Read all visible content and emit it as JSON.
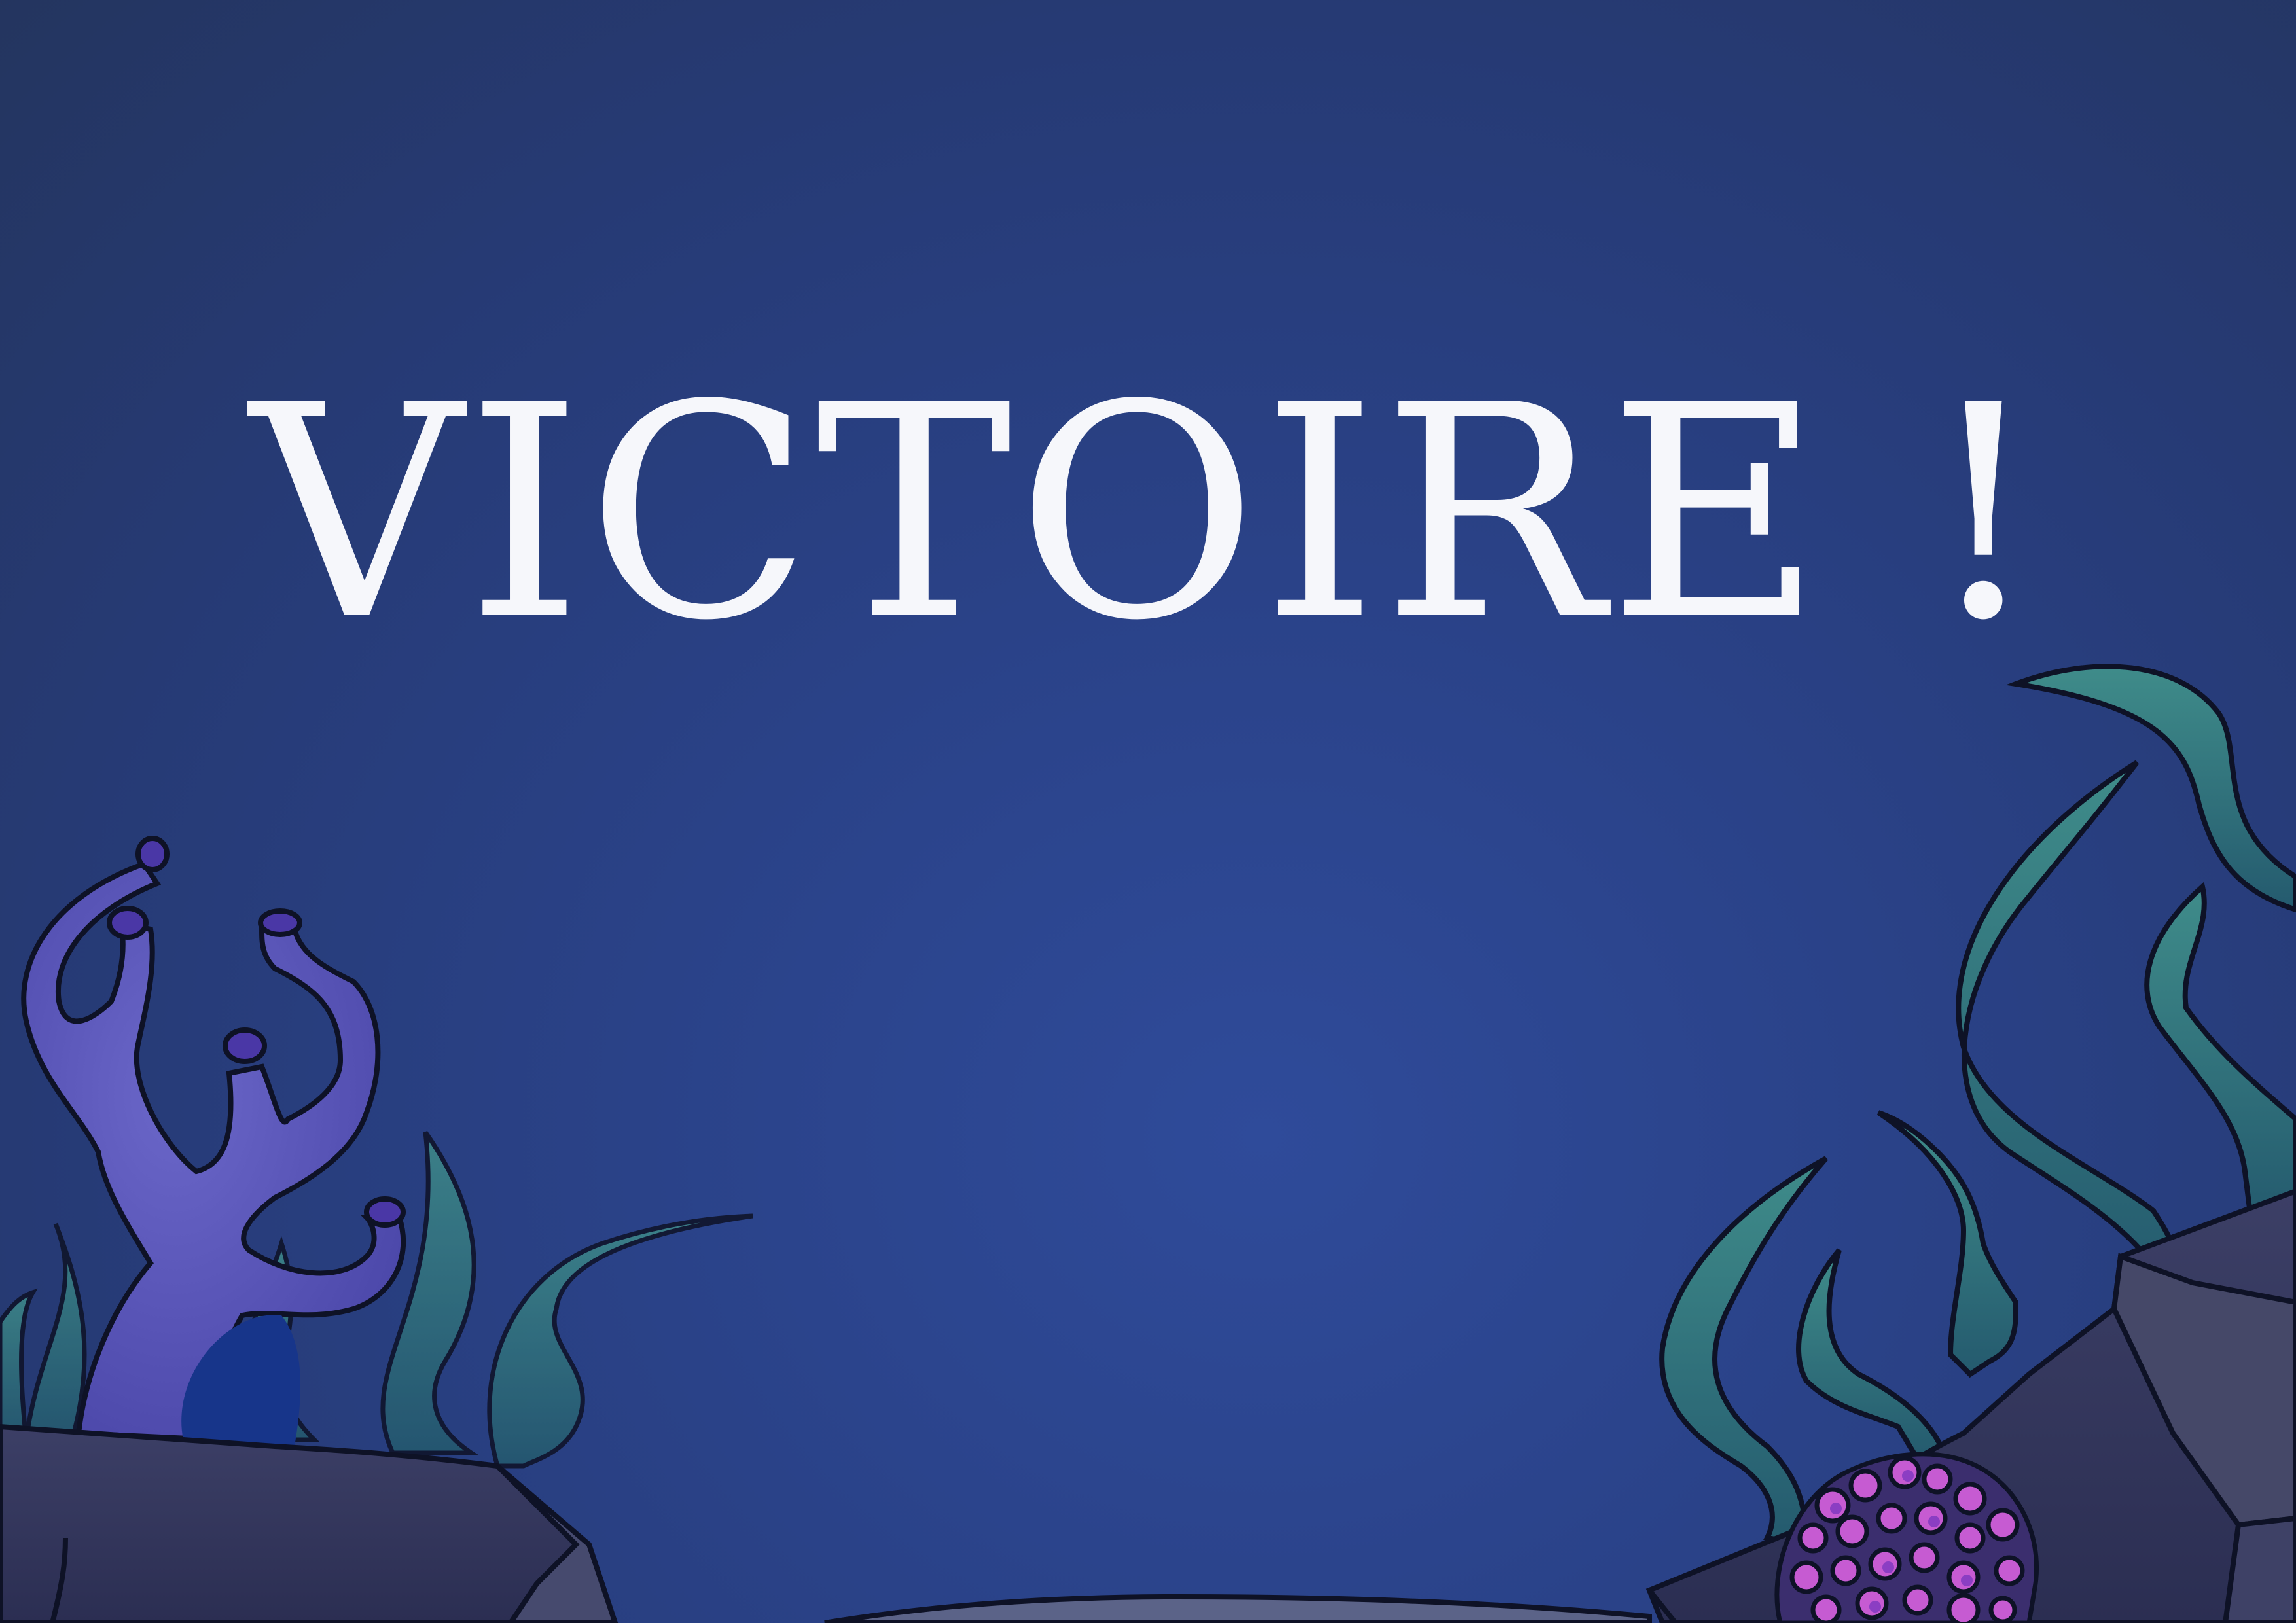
{
  "screen": {
    "title": "VICTOIRE !"
  },
  "colors": {
    "background_top": "#24355f",
    "background_center": "#2f4b9a",
    "title": "#f6f7fb",
    "outline": "#0e1226",
    "rock": "#3a3d62",
    "seaweed": "#2d6b78",
    "seaweed_light": "#3f8c8a",
    "purple_coral": "#5d56b8",
    "coral_tips": "#4a37a6",
    "pink_coral": "#c14fc9"
  },
  "decor": [
    "purple-coral",
    "seaweed-left",
    "seaweed-right",
    "rock-left",
    "rock-right",
    "pink-coral",
    "sand-floor"
  ]
}
